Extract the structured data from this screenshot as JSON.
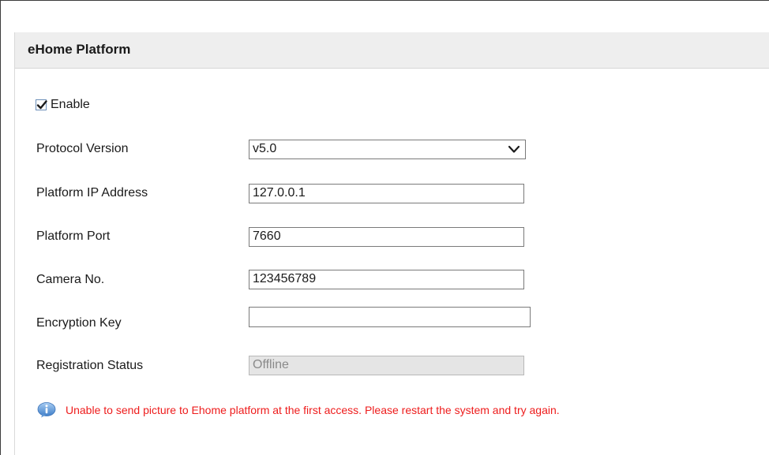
{
  "panel": {
    "title": "eHome Platform"
  },
  "form": {
    "enable": {
      "label": "Enable",
      "checked": true
    },
    "protocol_version": {
      "label": "Protocol Version",
      "value": "v5.0"
    },
    "platform_ip": {
      "label": "Platform IP Address",
      "value": "127.0.0.1"
    },
    "platform_port": {
      "label": "Platform Port",
      "value": "7660"
    },
    "camera_no": {
      "label": "Camera No.",
      "value": "123456789"
    },
    "encryption_key": {
      "label": "Encryption Key",
      "value": ""
    },
    "registration_status": {
      "label": "Registration Status",
      "value": "Offline"
    }
  },
  "notice": {
    "icon": "info-icon",
    "text": "Unable to send picture to Ehome platform at the first access. Please restart the system and try again.",
    "color": "#ee1c1c"
  },
  "colors": {
    "header_bg": "#eeeeee",
    "checkbox_border": "#6c8fb9",
    "disabled_field_bg": "#e5e5e5"
  }
}
